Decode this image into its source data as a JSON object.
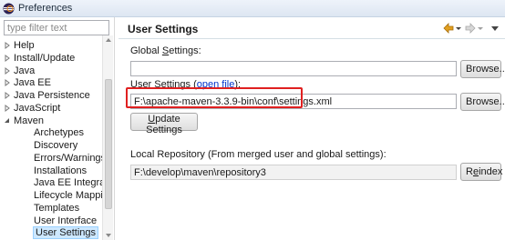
{
  "window": {
    "title": "Preferences"
  },
  "filter": {
    "placeholder": "type filter text"
  },
  "tree": {
    "items": [
      {
        "label": "Help",
        "expandable": true,
        "expanded": false,
        "depth": 0
      },
      {
        "label": "Install/Update",
        "expandable": true,
        "expanded": false,
        "depth": 0
      },
      {
        "label": "Java",
        "expandable": true,
        "expanded": false,
        "depth": 0
      },
      {
        "label": "Java EE",
        "expandable": true,
        "expanded": false,
        "depth": 0
      },
      {
        "label": "Java Persistence",
        "expandable": true,
        "expanded": false,
        "depth": 0
      },
      {
        "label": "JavaScript",
        "expandable": true,
        "expanded": false,
        "depth": 0
      },
      {
        "label": "Maven",
        "expandable": true,
        "expanded": true,
        "depth": 0
      },
      {
        "label": "Archetypes",
        "expandable": false,
        "depth": 1
      },
      {
        "label": "Discovery",
        "expandable": false,
        "depth": 1
      },
      {
        "label": "Errors/Warnings",
        "expandable": false,
        "depth": 1
      },
      {
        "label": "Installations",
        "expandable": false,
        "depth": 1
      },
      {
        "label": "Java EE Integration",
        "expandable": false,
        "depth": 1
      },
      {
        "label": "Lifecycle Mappings",
        "expandable": false,
        "depth": 1
      },
      {
        "label": "Templates",
        "expandable": false,
        "depth": 1
      },
      {
        "label": "User Interface",
        "expandable": false,
        "depth": 1
      },
      {
        "label": "User Settings",
        "expandable": false,
        "depth": 1,
        "selected": true
      }
    ]
  },
  "page": {
    "title": "User Settings"
  },
  "global_settings": {
    "label_pre": "Global ",
    "label_mnemonic": "S",
    "label_post": "ettings:",
    "value": "",
    "browse_label": "Browse..."
  },
  "user_settings": {
    "label_pre": "User ",
    "label_mnemonic": "S",
    "label_post": "ettings (",
    "link_text": "open file",
    "label_end": "):",
    "value": "F:\\apache-maven-3.3.9-bin\\conf\\settings.xml",
    "browse_label": "Browse..."
  },
  "update_settings": {
    "pre": "",
    "mnemonic": "U",
    "post": "pdate Settings"
  },
  "local_repository": {
    "label": "Local Repository (From merged user and global settings):",
    "value": "F:\\develop\\maven\\repository3",
    "reindex_pre": "R",
    "reindex_mnemonic": "e",
    "reindex_post": "index"
  },
  "colors": {
    "selection": "#cde8ff",
    "highlight_box": "#e02020",
    "link": "#0033cc",
    "nav_back": "#e2a020"
  },
  "icons": [
    "eclipse-app-icon",
    "back-arrow-icon",
    "forward-arrow-icon",
    "view-menu-icon",
    "tree-collapsed-icon",
    "tree-expanded-icon"
  ]
}
